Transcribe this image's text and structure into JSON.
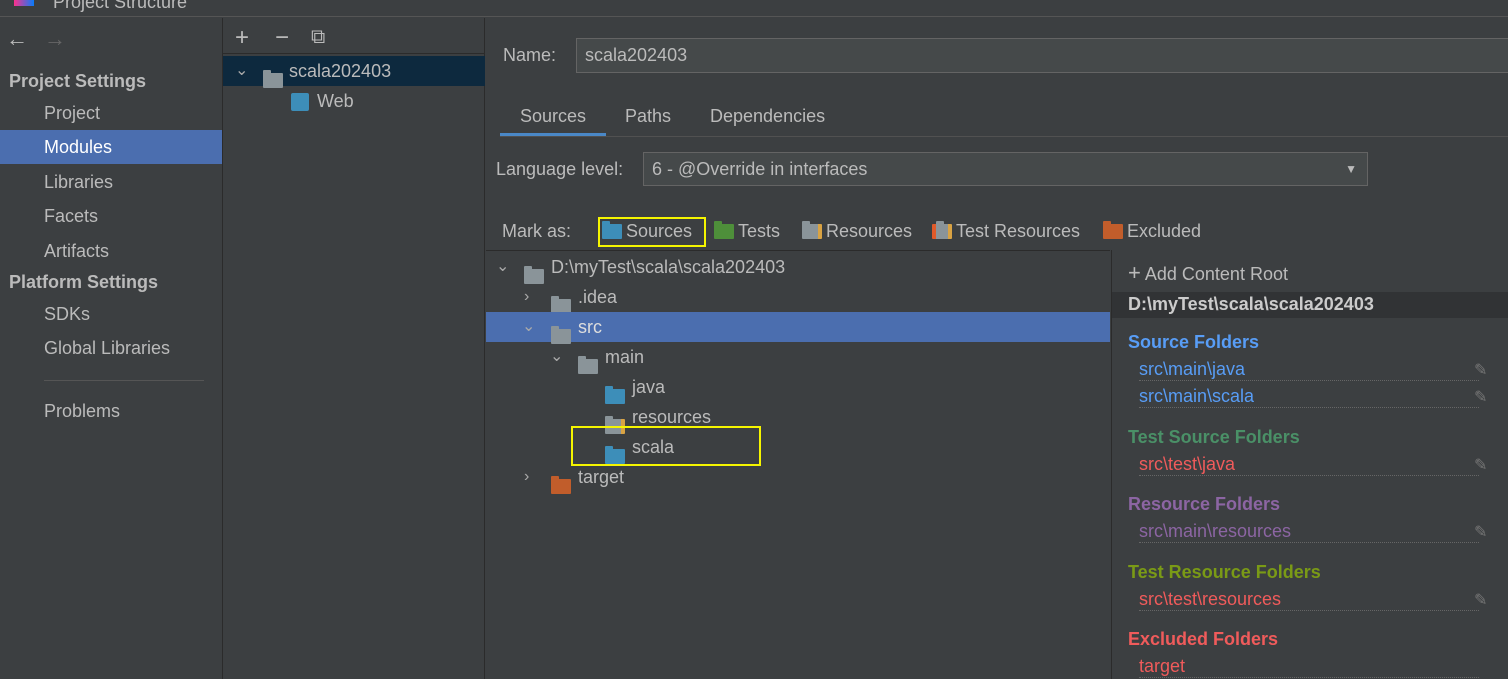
{
  "window": {
    "title": "Project Structure"
  },
  "sidebar": {
    "back": "←",
    "forward": "→",
    "project_settings": "Project Settings",
    "items": [
      {
        "label": "Project"
      },
      {
        "label": "Modules",
        "selected": true
      },
      {
        "label": "Libraries"
      },
      {
        "label": "Facets"
      },
      {
        "label": "Artifacts"
      }
    ],
    "platform_settings": "Platform Settings",
    "platform_items": [
      {
        "label": "SDKs"
      },
      {
        "label": "Global Libraries"
      }
    ],
    "problems": "Problems"
  },
  "modules": {
    "add": "+",
    "remove": "−",
    "copy": "⧉",
    "tree": [
      {
        "label": "scala202403",
        "expanded": true
      },
      {
        "label": "Web"
      }
    ]
  },
  "main": {
    "name_label": "Name:",
    "name_value": "scala202403",
    "tabs": [
      {
        "label": "Sources",
        "selected": true
      },
      {
        "label": "Paths"
      },
      {
        "label": "Dependencies"
      }
    ],
    "language_level_label": "Language level:",
    "language_level_value": "6 - @Override in interfaces",
    "mark_as_label": "Mark as:",
    "mark_as": [
      {
        "label": "Sources",
        "color": "#3d8eb9"
      },
      {
        "label": "Tests",
        "color": "#4e8f3a"
      },
      {
        "label": "Resources",
        "color": "#8a9499"
      },
      {
        "label": "Test Resources",
        "color": "#8a9499"
      },
      {
        "label": "Excluded",
        "color": "#c15d2b"
      }
    ],
    "tree": [
      {
        "label": "D:\\myTest\\scala\\scala202403",
        "chevron": "down"
      },
      {
        "label": ".idea",
        "chevron": "right"
      },
      {
        "label": "src",
        "chevron": "down",
        "selected": true
      },
      {
        "label": "main",
        "chevron": "down"
      },
      {
        "label": "java"
      },
      {
        "label": "resources"
      },
      {
        "label": "scala"
      },
      {
        "label": "target",
        "chevron": "right"
      }
    ]
  },
  "roots": {
    "add_content_root": "Add Content Root",
    "root": "D:\\myTest\\scala\\scala202403",
    "source_title": "Source Folders",
    "source": [
      "src\\main\\java",
      "src\\main\\scala"
    ],
    "test_source_title": "Test Source Folders",
    "test_source": [
      "src\\test\\java"
    ],
    "resource_title": "Resource Folders",
    "resource": [
      "src\\main\\resources"
    ],
    "test_resource_title": "Test Resource Folders",
    "test_resource": [
      "src\\test\\resources"
    ],
    "excluded_title": "Excluded Folders",
    "excluded": [
      "target"
    ],
    "colors": {
      "source": "#589df6",
      "test_source": "#4a9067",
      "resource": "#8c65a3",
      "test_resource": "#7a9a16",
      "excluded": "#f05b5b",
      "test_path": "#f05b5b"
    }
  }
}
